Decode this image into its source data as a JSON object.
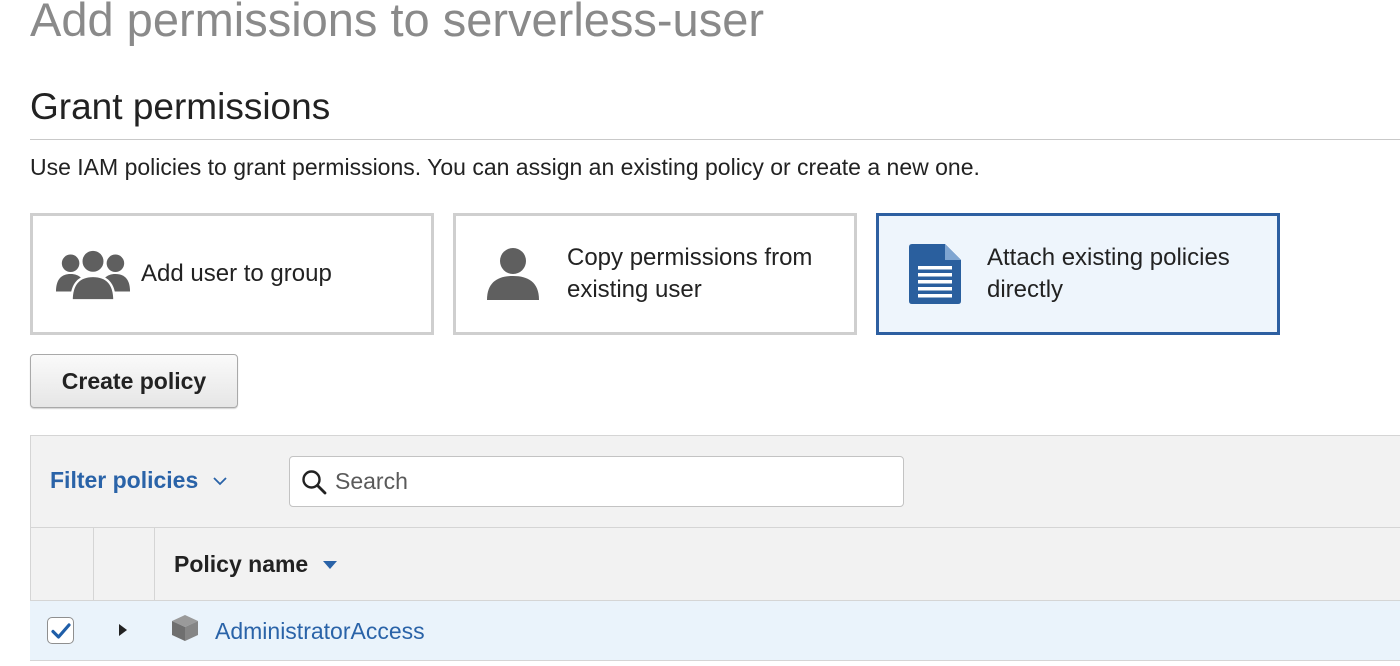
{
  "page": {
    "title": "Add permissions to serverless-user"
  },
  "grant": {
    "heading": "Grant permissions",
    "description": "Use IAM policies to grant permissions. You can assign an existing policy or create a new one."
  },
  "options": [
    {
      "label": "Add user to group",
      "icon": "user-group-icon",
      "selected": false
    },
    {
      "label_line1": "Copy permissions from",
      "label_line2": "existing user",
      "icon": "user-icon",
      "selected": false
    },
    {
      "label_line1": "Attach existing policies",
      "label_line2": "directly",
      "icon": "document-icon",
      "selected": true
    }
  ],
  "toolbar": {
    "create_policy_label": "Create policy"
  },
  "filter": {
    "label": "Filter policies",
    "search_placeholder": "Search"
  },
  "table": {
    "columns": [
      "",
      "",
      "Policy name"
    ],
    "rows": [
      {
        "checked": true,
        "name": "AdministratorAccess",
        "icon": "aws-managed-policy-icon"
      }
    ]
  },
  "colors": {
    "accent": "#2d5fa1",
    "link": "#2a63a8",
    "selected_bg": "#eef5fc",
    "row_selected_bg": "#eaf3fb",
    "icon_gray": "#5f5f5f",
    "document_blue": "#2a5f9e"
  }
}
